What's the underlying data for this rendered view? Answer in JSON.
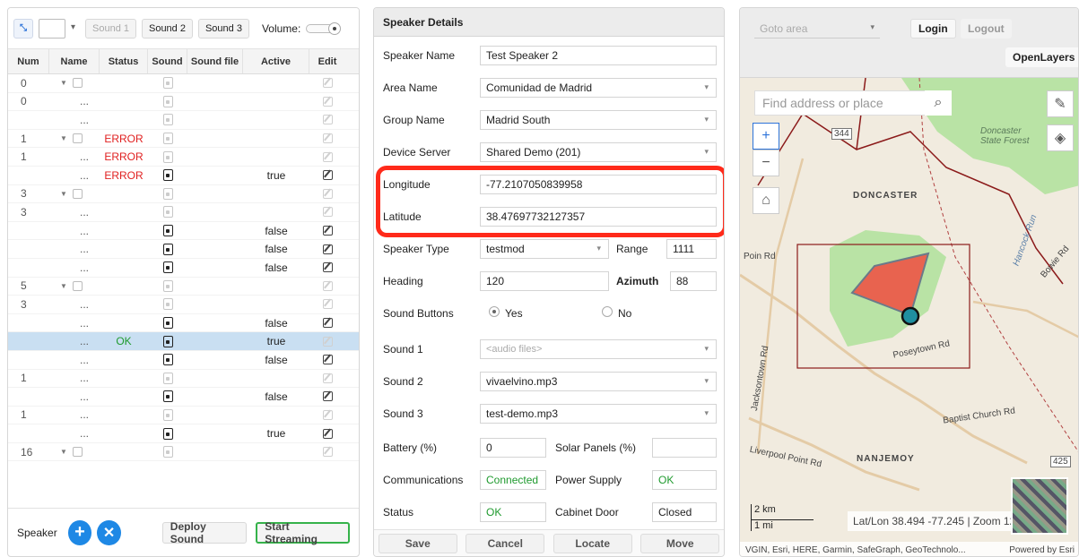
{
  "left": {
    "toolbar": {
      "sound1": "Sound 1",
      "sound2": "Sound 2",
      "sound3": "Sound 3",
      "volume": "Volume:"
    },
    "headers": [
      "Num",
      "Name",
      "Status",
      "Sound",
      "Sound file",
      "Active",
      "Edit"
    ],
    "rows": [
      {
        "num": "0",
        "name": "",
        "group": true,
        "status": "",
        "sound_dim": true,
        "active": "",
        "edit_dim": true
      },
      {
        "num": "0",
        "name": "...",
        "group": false,
        "status": "",
        "sound_dim": true,
        "active": "",
        "edit_dim": true
      },
      {
        "num": "",
        "name": "...",
        "group": false,
        "status": "",
        "sound_dim": true,
        "active": "",
        "edit_dim": true
      },
      {
        "num": "1",
        "name": "",
        "group": true,
        "status": "ERROR",
        "sound_dim": true,
        "active": "",
        "edit_dim": true
      },
      {
        "num": "1",
        "name": "...",
        "group": false,
        "status": "ERROR",
        "sound_dim": true,
        "active": "",
        "edit_dim": true
      },
      {
        "num": "",
        "name": "...",
        "group": false,
        "status": "ERROR",
        "sound_dim": false,
        "active": "true",
        "edit_dim": false
      },
      {
        "num": "3",
        "name": "",
        "group": true,
        "status": "",
        "sound_dim": true,
        "active": "",
        "edit_dim": true
      },
      {
        "num": "3",
        "name": "...",
        "group": false,
        "status": "",
        "sound_dim": true,
        "active": "",
        "edit_dim": true
      },
      {
        "num": "",
        "name": "...",
        "group": false,
        "status": "",
        "sound_dim": false,
        "active": "false",
        "edit_dim": false
      },
      {
        "num": "",
        "name": "...",
        "group": false,
        "status": "",
        "sound_dim": false,
        "active": "false",
        "edit_dim": false
      },
      {
        "num": "",
        "name": "...",
        "group": false,
        "status": "",
        "sound_dim": false,
        "active": "false",
        "edit_dim": false
      },
      {
        "num": "5",
        "name": "",
        "group": true,
        "status": "",
        "sound_dim": true,
        "active": "",
        "edit_dim": true
      },
      {
        "num": "3",
        "name": "...",
        "group": false,
        "status": "",
        "sound_dim": true,
        "active": "",
        "edit_dim": true
      },
      {
        "num": "",
        "name": "...",
        "group": false,
        "status": "",
        "sound_dim": false,
        "active": "false",
        "edit_dim": false
      },
      {
        "num": "",
        "name": "...",
        "group": false,
        "status": "OK",
        "sound_dim": false,
        "active": "true",
        "edit_dim": true,
        "selected": true
      },
      {
        "num": "",
        "name": "...",
        "group": false,
        "status": "",
        "sound_dim": false,
        "active": "false",
        "edit_dim": false
      },
      {
        "num": "1",
        "name": "...",
        "group": false,
        "status": "",
        "sound_dim": true,
        "active": "",
        "edit_dim": true
      },
      {
        "num": "",
        "name": "...",
        "group": false,
        "status": "",
        "sound_dim": false,
        "active": "false",
        "edit_dim": false
      },
      {
        "num": "1",
        "name": "...",
        "group": false,
        "status": "",
        "sound_dim": true,
        "active": "",
        "edit_dim": true
      },
      {
        "num": "",
        "name": "...",
        "group": false,
        "status": "",
        "sound_dim": false,
        "active": "true",
        "edit_dim": false
      },
      {
        "num": "16",
        "name": "",
        "group": true,
        "status": "",
        "sound_dim": true,
        "active": "",
        "edit_dim": true
      }
    ],
    "footer": {
      "speaker": "Speaker",
      "deploy": "Deploy Sound",
      "stream": "Start Streaming"
    }
  },
  "details": {
    "title": "Speaker Details",
    "speaker_name_label": "Speaker Name",
    "speaker_name": "Test Speaker 2",
    "area_name_label": "Area Name",
    "area_name": "Comunidad de Madrid",
    "group_name_label": "Group Name",
    "group_name": "Madrid South",
    "device_server_label": "Device Server",
    "device_server": "Shared Demo (201)",
    "longitude_label": "Longitude",
    "longitude": "-77.2107050839958",
    "latitude_label": "Latitude",
    "latitude": "38.47697732127357",
    "speaker_type_label": "Speaker Type",
    "speaker_type": "testmod",
    "range_label": "Range",
    "range": "1111",
    "heading_label": "Heading",
    "heading": "120",
    "azimuth_label": "Azimuth",
    "azimuth": "88",
    "sound_buttons_label": "Sound Buttons",
    "yes": "Yes",
    "no": "No",
    "sound1_label": "Sound 1",
    "sound1_placeholder": "<audio files>",
    "sound2_label": "Sound 2",
    "sound2": "vivaelvino.mp3",
    "sound3_label": "Sound 3",
    "sound3": "test-demo.mp3",
    "battery_label": "Battery (%)",
    "battery": "0",
    "solar_label": "Solar Panels (%)",
    "solar": "",
    "comms_label": "Communications",
    "comms": "Connected",
    "power_label": "Power Supply",
    "power": "OK",
    "status_label": "Status",
    "status": "OK",
    "cabinet_label": "Cabinet Door",
    "cabinet": "Closed",
    "buttons": {
      "save": "Save",
      "cancel": "Cancel",
      "locate": "Locate",
      "move": "Move"
    }
  },
  "map": {
    "goto_placeholder": "Goto area",
    "login": "Login",
    "logout": "Logout",
    "openlayers": "OpenLayers",
    "search_placeholder": "Find address or place",
    "labels": {
      "doncaster": "DONCASTER",
      "forest": "Doncaster State Forest",
      "nanjemoy": "NANJEMOY",
      "poseytown": "Poseytown Rd",
      "baptist": "Baptist Church Rd",
      "liverpool": "Liverpool Point Rd",
      "jackson": "Jacksontown Rd",
      "bowie": "Bowie Rd",
      "hancock": "Hancock Run",
      "poin": "Poin Rd",
      "r344": "344",
      "r425": "425"
    },
    "scale_km": "2 km",
    "scale_mi": "1 mi",
    "latlon": "Lat/Lon 38.494 -77.245 | Zoom 12",
    "attribution": "VGIN, Esri, HERE, Garmin, SafeGraph, GeoTechnolo...",
    "powered": "Powered by Esri"
  }
}
